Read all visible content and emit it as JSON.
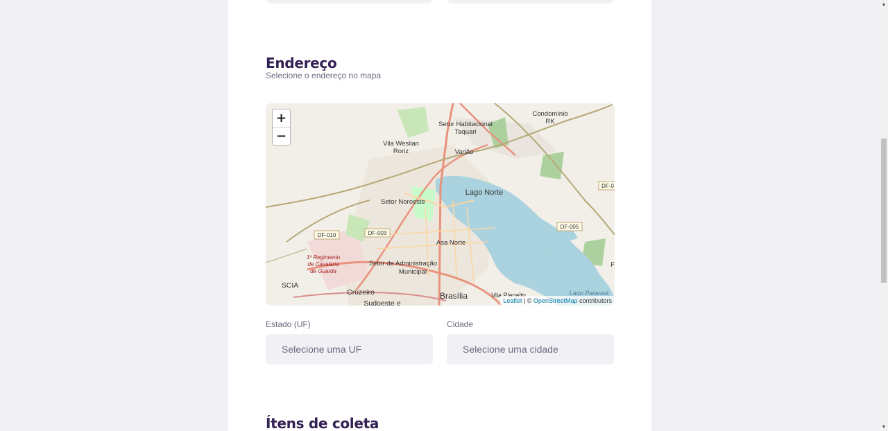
{
  "address_section": {
    "title": "Endereço",
    "subtitle": "Selecione o endereço no mapa"
  },
  "map": {
    "zoom_in_label": "+",
    "zoom_out_label": "−",
    "attribution": {
      "leaflet": "Leaflet",
      "separator": " | © ",
      "osm": "OpenStreetMap",
      "suffix": " contributors"
    },
    "place_labels": {
      "condominio_rk_1": "Condomínio",
      "condominio_rk_2": "RK",
      "setor_hab_1": "Setor Habitacional",
      "setor_hab_2": "Taquari",
      "vila_weslian_1": "Vila Weslian",
      "vila_weslian_2": "Roriz",
      "varjao": "Varjão",
      "lago_norte": "Lago Norte",
      "setor_noroeste": "Setor Noroeste",
      "df_010": "DF-010",
      "df_003": "DF-003",
      "df_005": "DF-005",
      "df_0": "DF-0",
      "asa_norte": "Asa Norte",
      "regimento_1": "1º Regimento",
      "regimento_2": "de Cavalaria",
      "regimento_3": "de Guarda",
      "setor_adm_1": "Setor de Administração",
      "setor_adm_2": "Municipal",
      "scia": "SCIA",
      "cruzeiro": "Cruzeiro",
      "sudoeste": "Sudoeste e",
      "brasilia": "Brasília",
      "vila_planalto": "Vila Planalto",
      "lago_paranoa": "Lago Paranoá",
      "edge_f": "F"
    }
  },
  "fields": {
    "uf_label": "Estado (UF)",
    "uf_placeholder": "Selecione uma UF",
    "city_label": "Cidade",
    "city_placeholder": "Selecione uma cidade"
  },
  "items_section": {
    "title": "Ítens de coleta"
  },
  "colors": {
    "page_bg": "#f0f0f5",
    "title": "#322153",
    "muted_text": "#6c6c80",
    "lake": "#aad3df",
    "major_road": "#e8927c",
    "secondary_road": "#fcd6a4"
  },
  "scrollbar": {
    "up_icon": "▲",
    "down_icon": "▼"
  }
}
